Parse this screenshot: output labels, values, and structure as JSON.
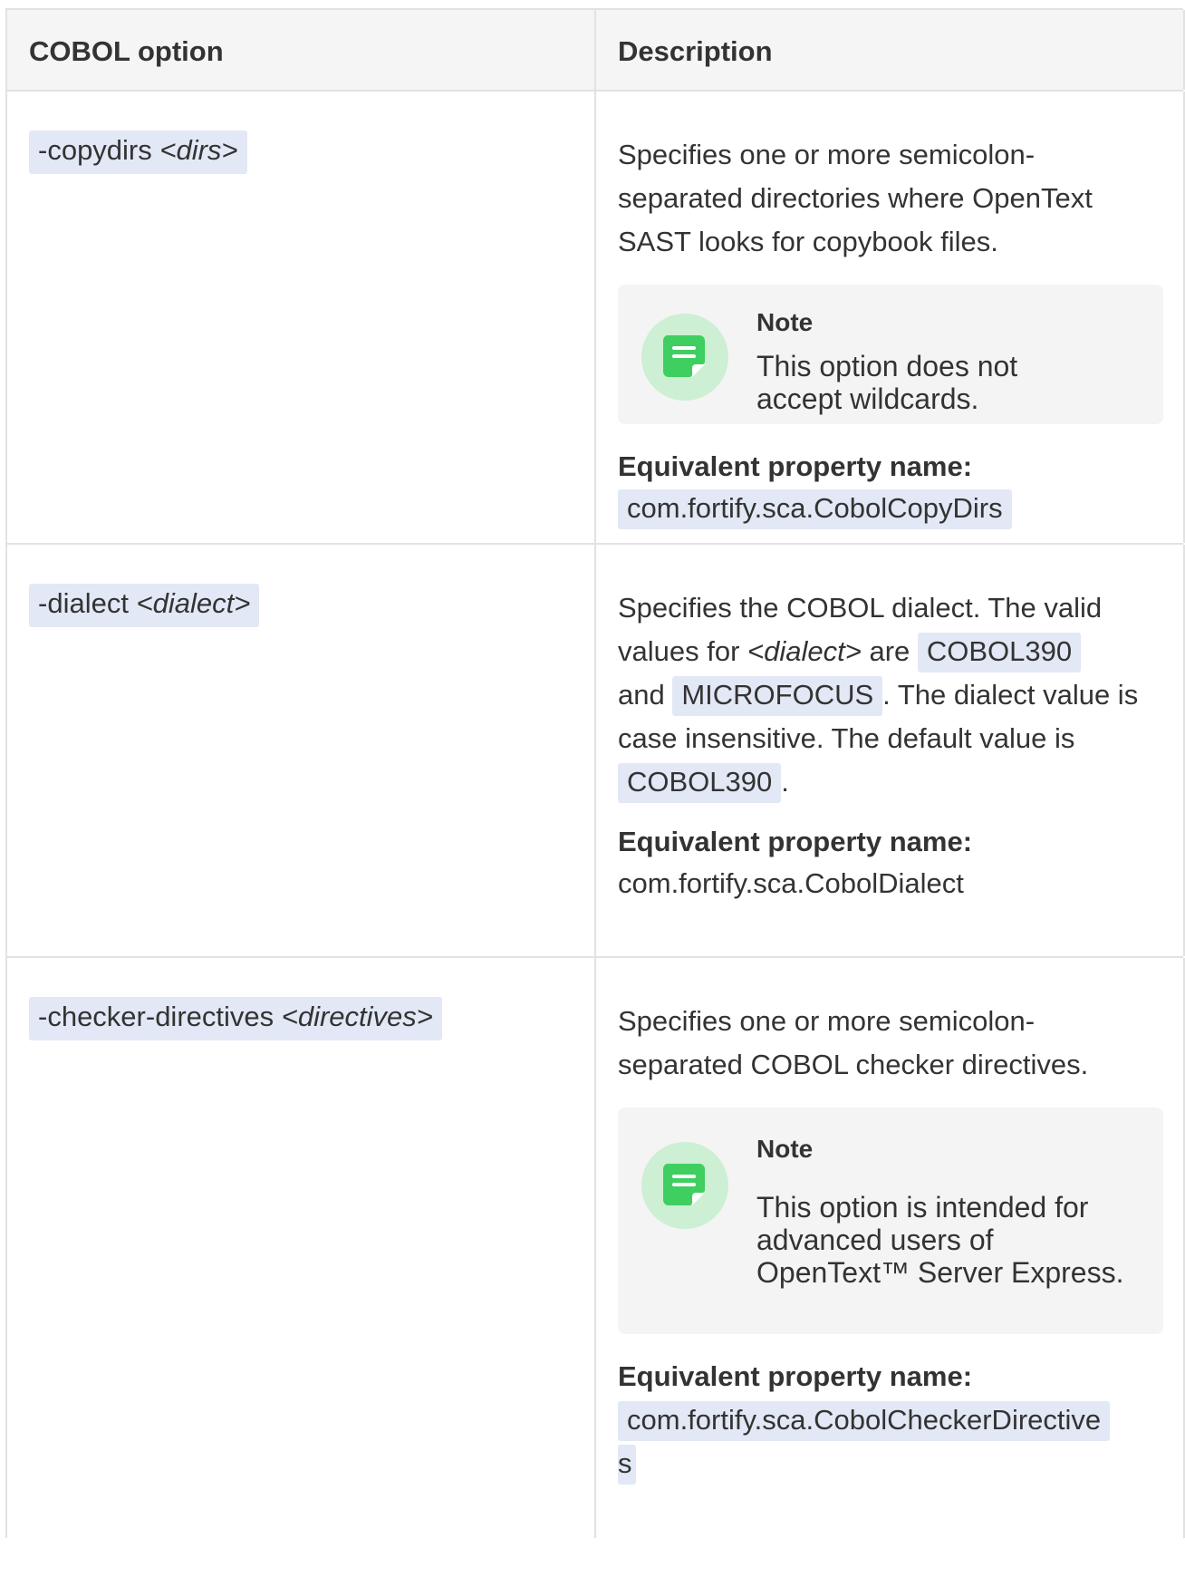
{
  "table": {
    "headers": [
      "COBOL option",
      "Description"
    ],
    "rows": [
      {
        "option_name": "-copydirs ",
        "option_arg": "<dirs>",
        "description": "Specifies one or more semicolon-separated directories where OpenText SAST looks for copybook files.",
        "note_title": "Note",
        "note_text": "This option does not accept wildcards.",
        "property_label": "Equivalent property name:",
        "property_value": "com.fortify.sca.CobolCopyDirs"
      },
      {
        "option_name": "-dialect ",
        "option_arg": "<dialect>",
        "description_parts": {
          "p1": "Specifies the COBOL dialect. The valid values for ",
          "arg": "<dialect>",
          "p2": " are ",
          "v1": "COBOL390",
          "p3": " and ",
          "v2": "MICROFOCUS",
          "p4": ". The dialect value is case insensitive. The default value is ",
          "v3": "COBOL390",
          "p5": "."
        },
        "property_label": "Equivalent property name:",
        "property_value": "com.fortify.sca.CobolDialect"
      },
      {
        "option_name": "-checker-directives ",
        "option_arg": "<directives>",
        "description": "Specifies one or more semicolon-separated COBOL checker directives.",
        "note_title": "Note",
        "note_text": "This option is intended for advanced users of OpenText™ Server Express.",
        "property_label": "Equivalent property name:",
        "property_value_line1": "com.fortify.sca.CobolCheckerDirective",
        "property_value_line2": "s"
      }
    ]
  },
  "colors": {
    "code_bg": "#e2e8f5",
    "note_bg": "#f4f4f4",
    "note_icon_circle": "#cdefd3",
    "note_icon": "#3ecf60",
    "header_bg": "#f5f5f5",
    "border": "#e2e2e2"
  },
  "icons": [
    "note-icon"
  ]
}
